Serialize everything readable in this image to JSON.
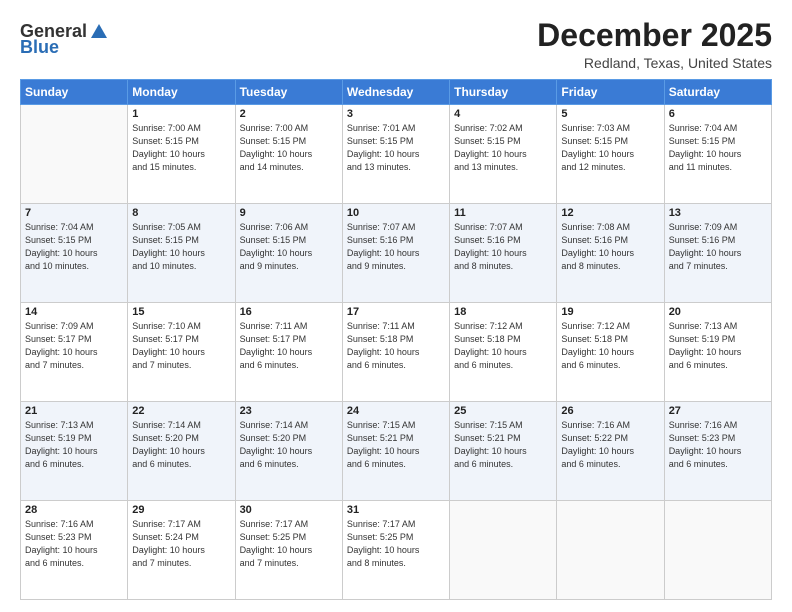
{
  "logo": {
    "general": "General",
    "blue": "Blue"
  },
  "title": "December 2025",
  "subtitle": "Redland, Texas, United States",
  "days_header": [
    "Sunday",
    "Monday",
    "Tuesday",
    "Wednesday",
    "Thursday",
    "Friday",
    "Saturday"
  ],
  "weeks": [
    [
      {
        "num": "",
        "detail": ""
      },
      {
        "num": "1",
        "detail": "Sunrise: 7:00 AM\nSunset: 5:15 PM\nDaylight: 10 hours\nand 15 minutes."
      },
      {
        "num": "2",
        "detail": "Sunrise: 7:00 AM\nSunset: 5:15 PM\nDaylight: 10 hours\nand 14 minutes."
      },
      {
        "num": "3",
        "detail": "Sunrise: 7:01 AM\nSunset: 5:15 PM\nDaylight: 10 hours\nand 13 minutes."
      },
      {
        "num": "4",
        "detail": "Sunrise: 7:02 AM\nSunset: 5:15 PM\nDaylight: 10 hours\nand 13 minutes."
      },
      {
        "num": "5",
        "detail": "Sunrise: 7:03 AM\nSunset: 5:15 PM\nDaylight: 10 hours\nand 12 minutes."
      },
      {
        "num": "6",
        "detail": "Sunrise: 7:04 AM\nSunset: 5:15 PM\nDaylight: 10 hours\nand 11 minutes."
      }
    ],
    [
      {
        "num": "7",
        "detail": "Sunrise: 7:04 AM\nSunset: 5:15 PM\nDaylight: 10 hours\nand 10 minutes."
      },
      {
        "num": "8",
        "detail": "Sunrise: 7:05 AM\nSunset: 5:15 PM\nDaylight: 10 hours\nand 10 minutes."
      },
      {
        "num": "9",
        "detail": "Sunrise: 7:06 AM\nSunset: 5:15 PM\nDaylight: 10 hours\nand 9 minutes."
      },
      {
        "num": "10",
        "detail": "Sunrise: 7:07 AM\nSunset: 5:16 PM\nDaylight: 10 hours\nand 9 minutes."
      },
      {
        "num": "11",
        "detail": "Sunrise: 7:07 AM\nSunset: 5:16 PM\nDaylight: 10 hours\nand 8 minutes."
      },
      {
        "num": "12",
        "detail": "Sunrise: 7:08 AM\nSunset: 5:16 PM\nDaylight: 10 hours\nand 8 minutes."
      },
      {
        "num": "13",
        "detail": "Sunrise: 7:09 AM\nSunset: 5:16 PM\nDaylight: 10 hours\nand 7 minutes."
      }
    ],
    [
      {
        "num": "14",
        "detail": "Sunrise: 7:09 AM\nSunset: 5:17 PM\nDaylight: 10 hours\nand 7 minutes."
      },
      {
        "num": "15",
        "detail": "Sunrise: 7:10 AM\nSunset: 5:17 PM\nDaylight: 10 hours\nand 7 minutes."
      },
      {
        "num": "16",
        "detail": "Sunrise: 7:11 AM\nSunset: 5:17 PM\nDaylight: 10 hours\nand 6 minutes."
      },
      {
        "num": "17",
        "detail": "Sunrise: 7:11 AM\nSunset: 5:18 PM\nDaylight: 10 hours\nand 6 minutes."
      },
      {
        "num": "18",
        "detail": "Sunrise: 7:12 AM\nSunset: 5:18 PM\nDaylight: 10 hours\nand 6 minutes."
      },
      {
        "num": "19",
        "detail": "Sunrise: 7:12 AM\nSunset: 5:18 PM\nDaylight: 10 hours\nand 6 minutes."
      },
      {
        "num": "20",
        "detail": "Sunrise: 7:13 AM\nSunset: 5:19 PM\nDaylight: 10 hours\nand 6 minutes."
      }
    ],
    [
      {
        "num": "21",
        "detail": "Sunrise: 7:13 AM\nSunset: 5:19 PM\nDaylight: 10 hours\nand 6 minutes."
      },
      {
        "num": "22",
        "detail": "Sunrise: 7:14 AM\nSunset: 5:20 PM\nDaylight: 10 hours\nand 6 minutes."
      },
      {
        "num": "23",
        "detail": "Sunrise: 7:14 AM\nSunset: 5:20 PM\nDaylight: 10 hours\nand 6 minutes."
      },
      {
        "num": "24",
        "detail": "Sunrise: 7:15 AM\nSunset: 5:21 PM\nDaylight: 10 hours\nand 6 minutes."
      },
      {
        "num": "25",
        "detail": "Sunrise: 7:15 AM\nSunset: 5:21 PM\nDaylight: 10 hours\nand 6 minutes."
      },
      {
        "num": "26",
        "detail": "Sunrise: 7:16 AM\nSunset: 5:22 PM\nDaylight: 10 hours\nand 6 minutes."
      },
      {
        "num": "27",
        "detail": "Sunrise: 7:16 AM\nSunset: 5:23 PM\nDaylight: 10 hours\nand 6 minutes."
      }
    ],
    [
      {
        "num": "28",
        "detail": "Sunrise: 7:16 AM\nSunset: 5:23 PM\nDaylight: 10 hours\nand 6 minutes."
      },
      {
        "num": "29",
        "detail": "Sunrise: 7:17 AM\nSunset: 5:24 PM\nDaylight: 10 hours\nand 7 minutes."
      },
      {
        "num": "30",
        "detail": "Sunrise: 7:17 AM\nSunset: 5:25 PM\nDaylight: 10 hours\nand 7 minutes."
      },
      {
        "num": "31",
        "detail": "Sunrise: 7:17 AM\nSunset: 5:25 PM\nDaylight: 10 hours\nand 8 minutes."
      },
      {
        "num": "",
        "detail": ""
      },
      {
        "num": "",
        "detail": ""
      },
      {
        "num": "",
        "detail": ""
      }
    ]
  ]
}
